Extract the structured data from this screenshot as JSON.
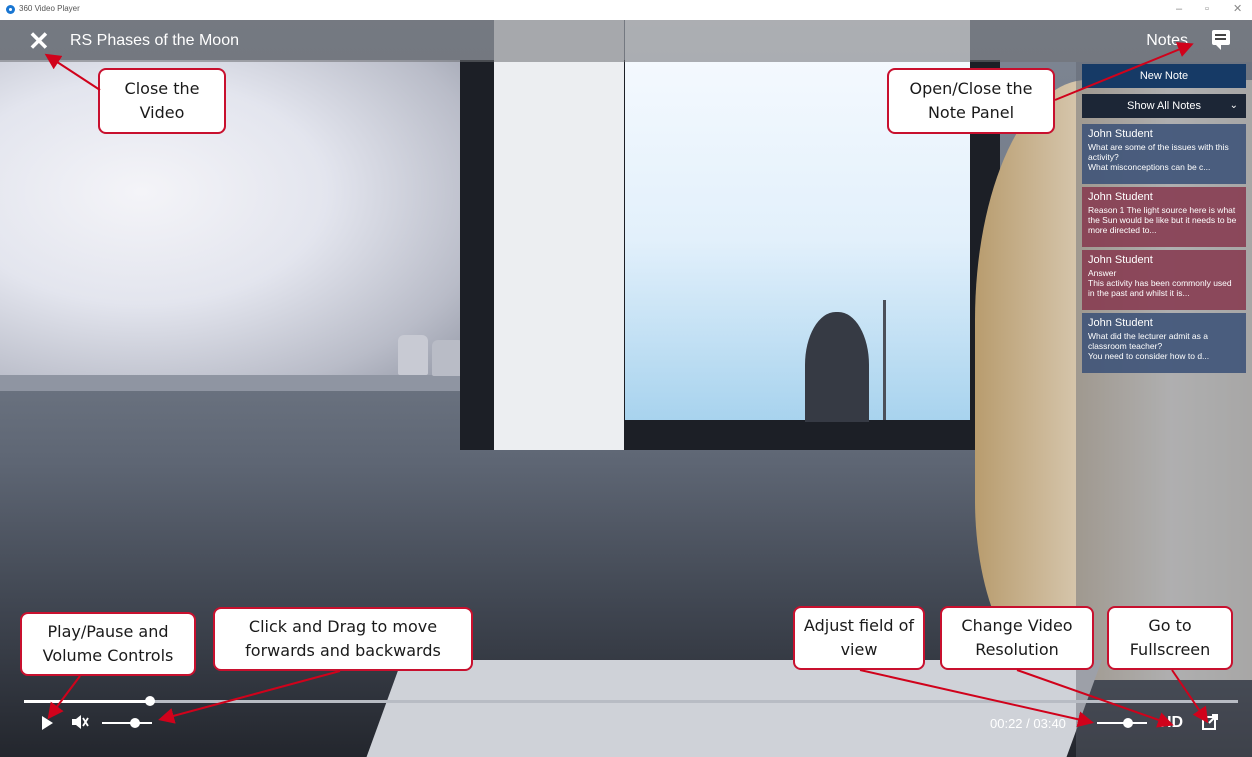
{
  "window": {
    "title": "360 Video Player",
    "minimize": "–",
    "restore": "▫",
    "close": "✕"
  },
  "header": {
    "close_glyph": "✕",
    "title": "RS Phases of the Moon",
    "notes_label": "Notes"
  },
  "notes_panel": {
    "new_note_label": "New Note",
    "filter_label": "Show All Notes",
    "notes": [
      {
        "author": "John Student",
        "text": "What are some of the issues with this activity?\nWhat misconceptions can be c...",
        "color": "#3c5278"
      },
      {
        "author": "John Student",
        "text": "Reason 1 The light source here is what the Sun would be like but it needs to be more directed to...",
        "color": "#863a50"
      },
      {
        "author": "John Student",
        "text": "Answer\nThis activity has been commonly used in the past and whilst it is...",
        "color": "#863a50"
      },
      {
        "author": "John Student",
        "text": "What did the lecturer admit as a classroom teacher?\nYou need to consider how to d...",
        "color": "#3c5278"
      }
    ]
  },
  "controls": {
    "current_time": "00:22",
    "duration": "03:40",
    "time_display": "00:22 / 03:40",
    "progress_fraction": 0.104,
    "volume_fraction": 0.66,
    "fov_fraction": 0.62,
    "resolution_label": "HD",
    "muted": true
  },
  "callouts": {
    "close_video": "Close the Video",
    "notes_panel": "Open/Close the Note Panel",
    "play_volume": "Play/Pause and Volume Controls",
    "seek": "Click and Drag to move forwards and backwards",
    "fov": "Adjust field of view",
    "resolution": "Change Video Resolution",
    "fullscreen": "Go to Fullscreen"
  },
  "colors": {
    "callout_border": "#c8102e",
    "new_note_bg": "#163a66",
    "note_blue": "#3c5278",
    "note_red": "#863a50"
  }
}
